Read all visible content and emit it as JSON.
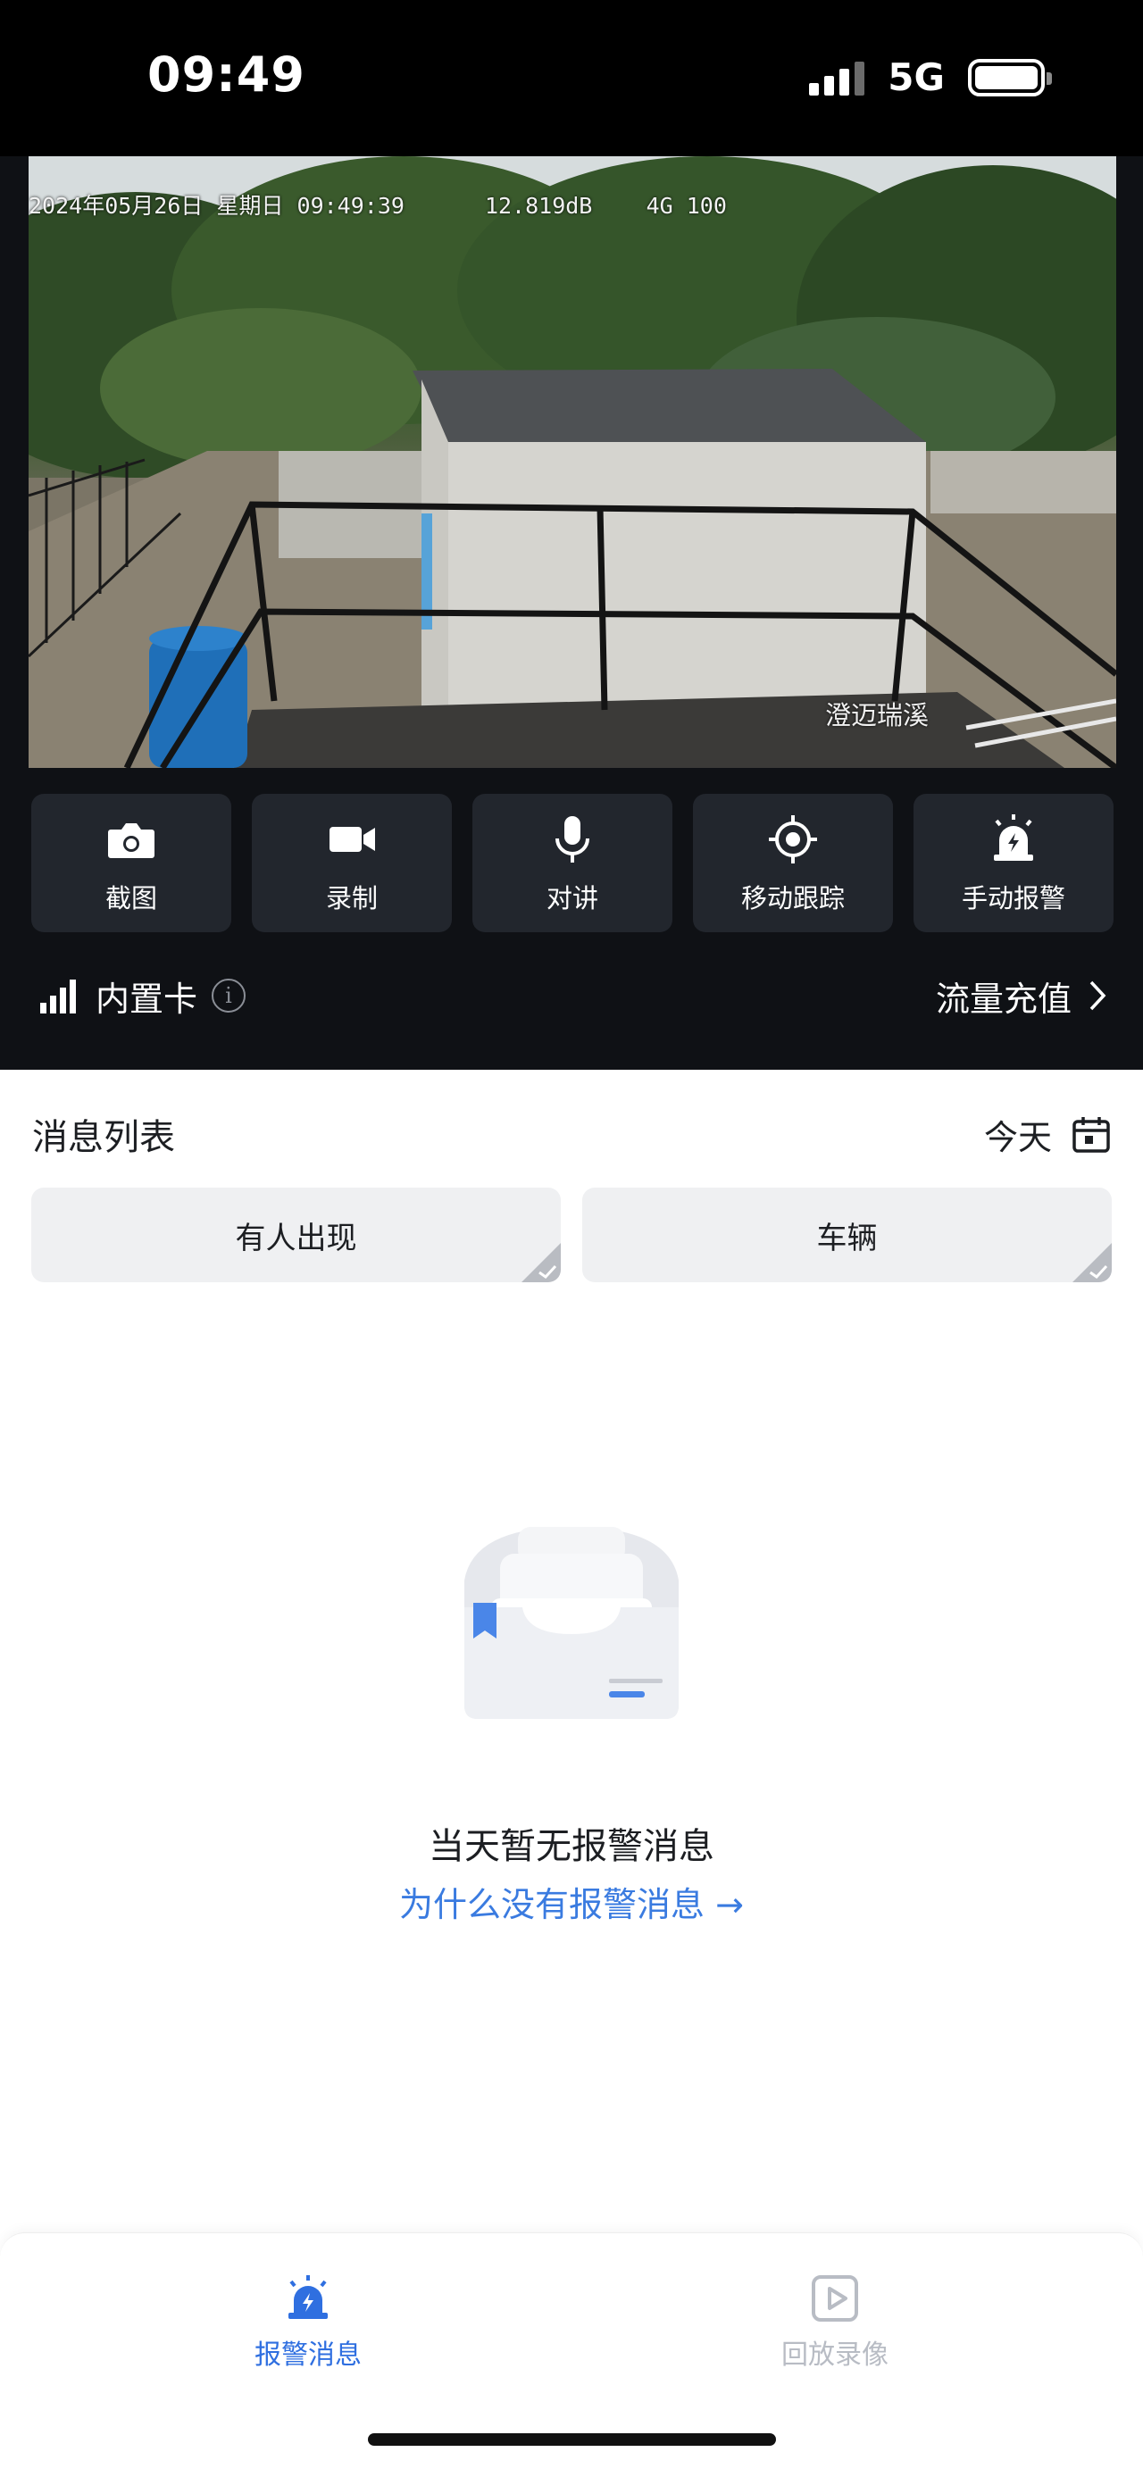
{
  "status_bar": {
    "time": "09:49",
    "network": "5G",
    "signal_bars_filled": 3,
    "battery_level": 1.0
  },
  "camera": {
    "osd_datetime": "2024年05月26日 星期日 09:49:39",
    "osd_status": "12.819dB",
    "osd_signal": "4G",
    "osd_battery": "100",
    "watermark": "澄迈瑞溪"
  },
  "controls": {
    "buttons": [
      {
        "label": "截图",
        "icon": "camera-icon"
      },
      {
        "label": "录制",
        "icon": "video-icon"
      },
      {
        "label": "对讲",
        "icon": "microphone-icon"
      },
      {
        "label": "移动跟踪",
        "icon": "target-icon"
      },
      {
        "label": "手动报警",
        "icon": "alarm-icon"
      }
    ],
    "sim_label": "内置卡",
    "recharge_label": "流量充值"
  },
  "messages": {
    "title": "消息列表",
    "date_filter": "今天",
    "filters": [
      "有人出现",
      "车辆"
    ],
    "empty_text": "当天暂无报警消息",
    "empty_link": "为什么没有报警消息 →"
  },
  "tab_bar": {
    "tabs": [
      {
        "label": "报警消息",
        "icon": "alarm-icon",
        "active": true
      },
      {
        "label": "回放录像",
        "icon": "playback-icon",
        "active": false
      }
    ]
  },
  "colors": {
    "accent": "#2f6fe0",
    "dark_panel": "#0f1115",
    "button_bg": "#22262d",
    "chip_bg": "#eff0f2"
  }
}
